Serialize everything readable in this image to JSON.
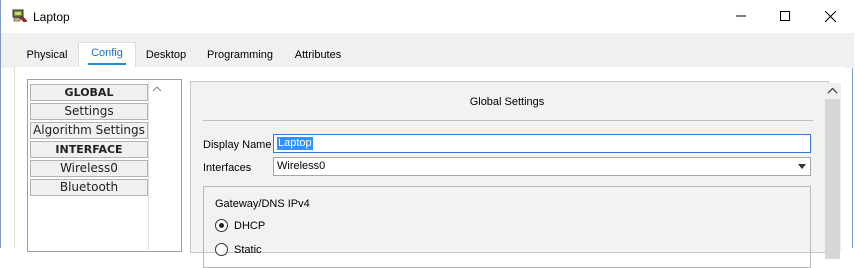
{
  "window": {
    "title": "Laptop",
    "controls": [
      "minimize",
      "maximize",
      "close"
    ]
  },
  "tabs": [
    {
      "label": "Physical",
      "active": false
    },
    {
      "label": "Config",
      "active": true
    },
    {
      "label": "Desktop",
      "active": false
    },
    {
      "label": "Programming",
      "active": false
    },
    {
      "label": "Attributes",
      "active": false
    }
  ],
  "sidebar": {
    "items": [
      {
        "label": "GLOBAL",
        "type": "header"
      },
      {
        "label": "Settings",
        "type": "item"
      },
      {
        "label": "Algorithm Settings",
        "type": "item"
      },
      {
        "label": "INTERFACE",
        "type": "header"
      },
      {
        "label": "Wireless0",
        "type": "item"
      },
      {
        "label": "Bluetooth",
        "type": "item"
      }
    ]
  },
  "main": {
    "section_title": "Global Settings",
    "display_name_label": "Display Name",
    "display_name_value": "Laptop",
    "interfaces_label": "Interfaces",
    "interfaces_value": "Wireless0",
    "group_title": "Gateway/DNS IPv4",
    "radio_dhcp": "DHCP",
    "radio_dhcp_selected": true,
    "radio_static": "Static",
    "radio_static_selected": false
  },
  "colors": {
    "active_tab_text": "#1f6fbf",
    "active_tab_underline": "#1f8bd6",
    "selection": "#3390ff",
    "focus_border": "#2b7bd6"
  }
}
